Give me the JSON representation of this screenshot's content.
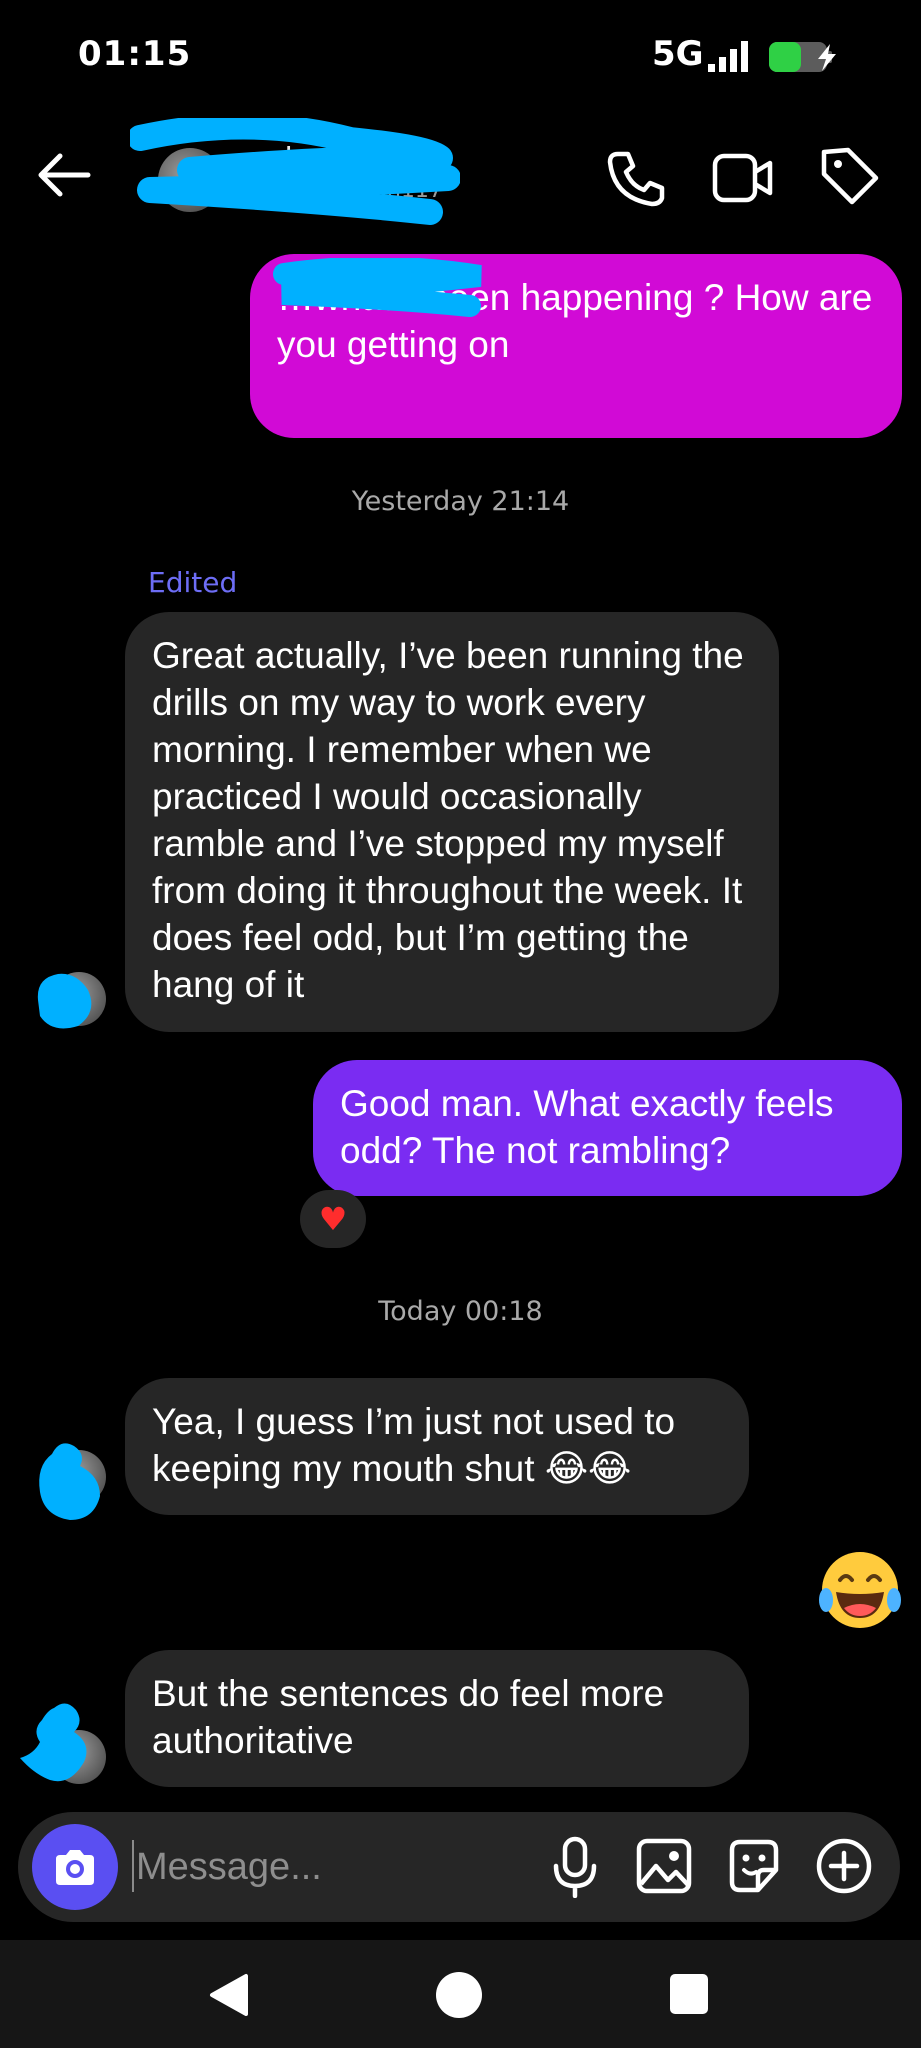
{
  "status_bar": {
    "time": "01:15",
    "network": "5G"
  },
  "header": {
    "name": "…el",
    "subtitle": "…man117"
  },
  "messages": [
    {
      "id": "out1",
      "text": "…what's been happening ? How are you getting on"
    },
    {
      "id": "ts1",
      "text": "Yesterday 21:14"
    },
    {
      "id": "edited",
      "text": "Edited"
    },
    {
      "id": "in1",
      "text": "Great actually, I’ve been running the drills on my way to work every morning. I remember  when we practiced I would occasionally ramble and I’ve stopped my myself from doing it throughout the week. It does feel odd, but I’m getting the hang of it"
    },
    {
      "id": "out2",
      "text": "Good man. What exactly feels odd? The not rambling?"
    },
    {
      "id": "reaction",
      "text": "❤️"
    },
    {
      "id": "ts2",
      "text": "Today 00:18"
    },
    {
      "id": "in2",
      "text": "Yea, I guess I’m just not used to keeping my mouth shut 😂😂"
    },
    {
      "id": "emoji",
      "text": "😂"
    },
    {
      "id": "in3",
      "text": "But the sentences do feel more authoritative"
    }
  ],
  "composer": {
    "placeholder": "Message..."
  },
  "colors": {
    "outgoing_magenta": "#d10ad6",
    "outgoing_purple": "#7a2cf2",
    "incoming": "#262626",
    "redaction": "#00b0ff",
    "edited": "#6d6df5"
  },
  "icons": [
    "back-arrow-icon",
    "phone-icon",
    "video-icon",
    "tag-icon",
    "camera-icon",
    "mic-icon",
    "image-icon",
    "sticker-icon",
    "plus-icon"
  ]
}
